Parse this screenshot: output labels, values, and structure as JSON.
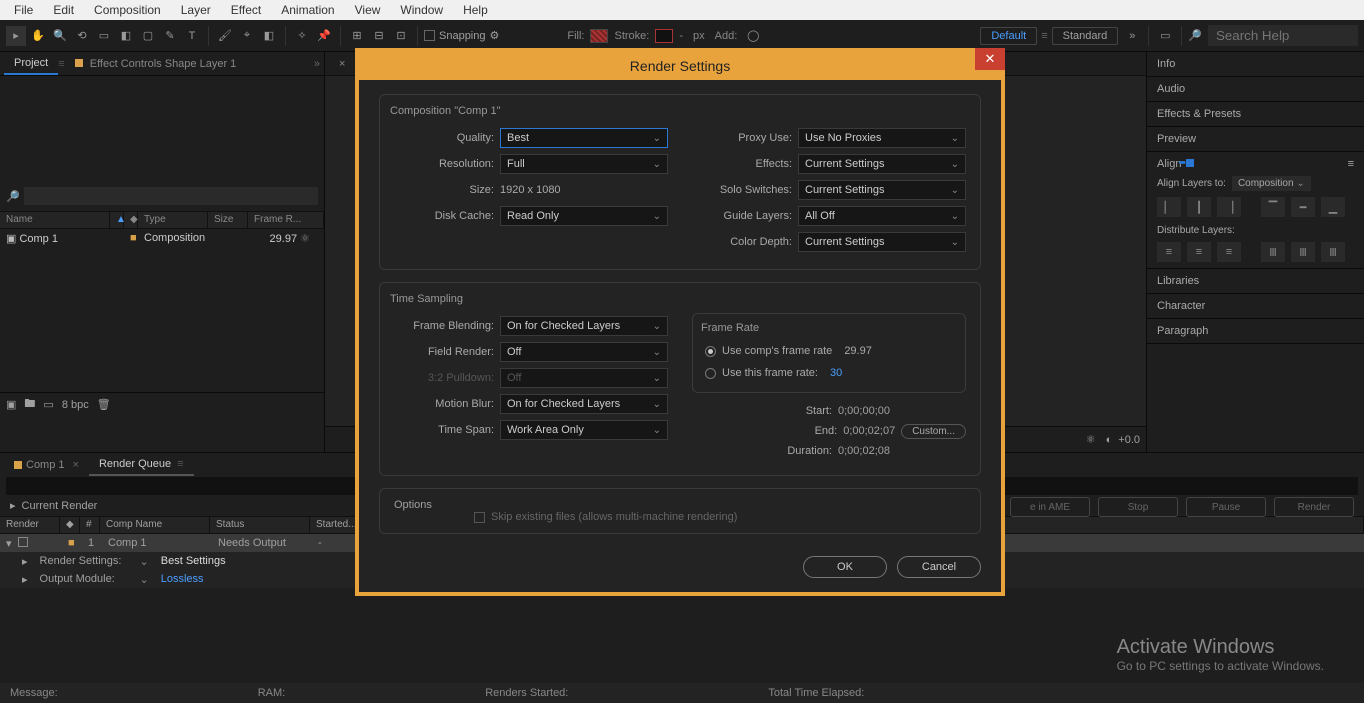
{
  "menu": {
    "items": [
      "File",
      "Edit",
      "Composition",
      "Layer",
      "Effect",
      "Animation",
      "View",
      "Window",
      "Help"
    ]
  },
  "toolbar": {
    "snapping": "Snapping",
    "fill": "Fill:",
    "stroke": "Stroke:",
    "px": "px",
    "add": "Add:",
    "default": "Default",
    "standard": "Standard",
    "search_ph": "Search Help"
  },
  "project": {
    "tab_project": "Project",
    "tab_effect": "Effect Controls Shape Layer 1",
    "cols": {
      "name": "Name",
      "type": "Type",
      "size": "Size",
      "fr": "Frame R..."
    },
    "row": {
      "name": "Comp 1",
      "type": "Composition",
      "fr": "29.97"
    },
    "bpc": "8 bpc"
  },
  "center": {
    "tab_close": "×"
  },
  "cstrip": {
    "zoom": "+0.0"
  },
  "rpanels": {
    "info": "Info",
    "audio": "Audio",
    "fx": "Effects & Presets",
    "preview": "Preview",
    "align": "Align",
    "align_to": "Align Layers to:",
    "align_sel": "Composition",
    "dist": "Distribute Layers:",
    "libraries": "Libraries",
    "character": "Character",
    "paragraph": "Paragraph"
  },
  "rqueue": {
    "tab_comp": "Comp 1",
    "tab_rq": "Render Queue",
    "current": "Current Render",
    "cols": {
      "render": "Render",
      "num": "#",
      "comp": "Comp Name",
      "status": "Status",
      "started": "Started..."
    },
    "row": {
      "num": "1",
      "comp": "Comp 1",
      "status": "Needs Output",
      "started": "-"
    },
    "rs_lbl": "Render Settings:",
    "rs_val": "Best Settings",
    "om_lbl": "Output Module:",
    "om_val": "Lossless",
    "btn_ame": "e in AME",
    "btn_stop": "Stop",
    "btn_pause": "Pause",
    "btn_render": "Render"
  },
  "status": {
    "msg": "Message:",
    "ram": "RAM:",
    "rs": "Renders Started:",
    "tte": "Total Time Elapsed:"
  },
  "wm": {
    "t": "Activate Windows",
    "s": "Go to PC settings to activate Windows."
  },
  "dialog": {
    "title": "Render Settings",
    "close": "✕",
    "comp_leg": "Composition \"Comp 1\"",
    "quality_l": "Quality:",
    "quality_v": "Best",
    "res_l": "Resolution:",
    "res_v": "Full",
    "size_l": "Size:",
    "size_v": "1920 x 1080",
    "disk_l": "Disk Cache:",
    "disk_v": "Read Only",
    "proxy_l": "Proxy Use:",
    "proxy_v": "Use No Proxies",
    "fx_l": "Effects:",
    "fx_v": "Current Settings",
    "solo_l": "Solo Switches:",
    "solo_v": "Current Settings",
    "guide_l": "Guide Layers:",
    "guide_v": "All Off",
    "depth_l": "Color Depth:",
    "depth_v": "Current Settings",
    "ts_leg": "Time Sampling",
    "fb_l": "Frame Blending:",
    "fb_v": "On for Checked Layers",
    "fr_l": "Field Render:",
    "fr_v": "Off",
    "pd_l": "3:2 Pulldown:",
    "pd_v": "Off",
    "mb_l": "Motion Blur:",
    "mb_v": "On for Checked Layers",
    "tspan_l": "Time Span:",
    "tspan_v": "Work Area Only",
    "rate_leg": "Frame Rate",
    "rate_comp": "Use comp's frame rate",
    "rate_comp_v": "29.97",
    "rate_this": "Use this frame rate:",
    "rate_this_v": "30",
    "t_start_l": "Start:",
    "t_start_v": "0;00;00;00",
    "t_end_l": "End:",
    "t_end_v": "0;00;02;07",
    "t_dur_l": "Duration:",
    "t_dur_v": "0;00;02;08",
    "custom": "Custom...",
    "opts_leg": "Options",
    "skip": "Skip existing files (allows multi-machine rendering)",
    "ok": "OK",
    "cancel": "Cancel"
  }
}
